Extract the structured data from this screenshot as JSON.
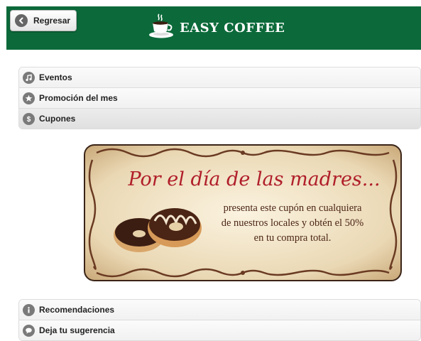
{
  "header": {
    "back_label": "Regresar",
    "brand_title": "EASY COFFEE",
    "color": "#0c6a3a"
  },
  "menu_top": [
    {
      "label": "Eventos",
      "icon": "music-note-icon"
    },
    {
      "label": "Promoción del mes",
      "icon": "star-icon"
    },
    {
      "label": "Cupones",
      "icon": "dollar-icon",
      "active": true
    }
  ],
  "coupon": {
    "script_title": "Por el día de las madres...",
    "body": "presenta este cupón en cualquiera\nde nuestros locales y obtén el 50%\nen tu compra total."
  },
  "menu_bottom": [
    {
      "label": "Recomendaciones",
      "icon": "info-icon"
    },
    {
      "label": "Deja tu sugerencia",
      "icon": "comment-icon"
    }
  ]
}
